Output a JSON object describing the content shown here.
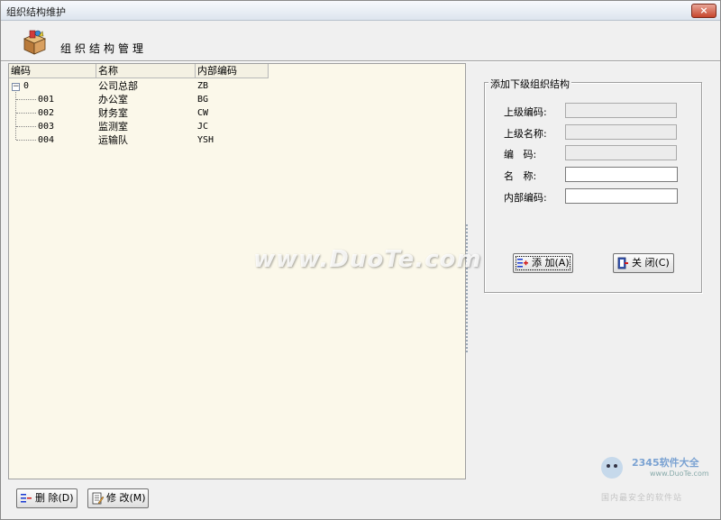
{
  "window": {
    "title": "组织结构维护",
    "close_symbol": "×"
  },
  "header": {
    "title": "组织结构管理",
    "icon": "box-gift-icon"
  },
  "tree": {
    "columns": [
      "编码",
      "名称",
      "内部编码"
    ],
    "rows": [
      {
        "code": "0",
        "name": "公司总部",
        "inner": "ZB",
        "level": 0,
        "expander": "−"
      },
      {
        "code": "001",
        "name": "办公室",
        "inner": "BG",
        "level": 1
      },
      {
        "code": "002",
        "name": "财务室",
        "inner": "CW",
        "level": 1
      },
      {
        "code": "003",
        "name": "监测室",
        "inner": "JC",
        "level": 1
      },
      {
        "code": "004",
        "name": "运输队",
        "inner": "YSH",
        "level": 1
      }
    ]
  },
  "form": {
    "group_title": "添加下级组织结构",
    "fields": [
      {
        "label": "上级编码:",
        "value": ""
      },
      {
        "label": "上级名称:",
        "value": ""
      },
      {
        "label": "编   码:",
        "value": ""
      },
      {
        "label": "名   称:",
        "value": ""
      },
      {
        "label": "内部编码:",
        "value": ""
      }
    ],
    "add_button": "添 加(A)",
    "close_button": "关 闭(C)"
  },
  "footer": {
    "delete_button": "删 除(D)",
    "edit_button": "修 改(M)"
  },
  "watermark": {
    "text": "www.DuoTe.com"
  },
  "corner_logo": {
    "brand": "2345软件大全",
    "url": "www.DuoTe.com",
    "slogan": "国内最安全的软件站"
  },
  "colors": {
    "tree_bg": "#fbf8ea",
    "window_bg": "#f0f0f0",
    "close_red": "#c6452c"
  }
}
